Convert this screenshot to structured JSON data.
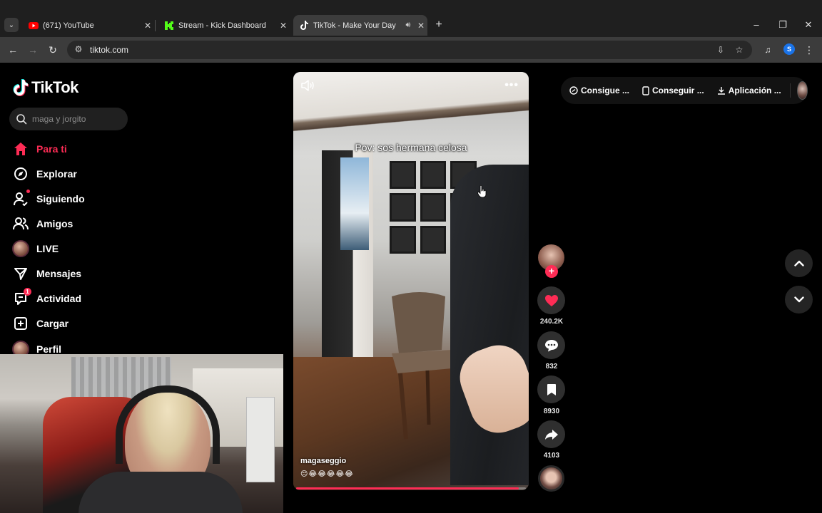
{
  "browser": {
    "tabs": [
      {
        "title": "(671) YouTube",
        "favicon": "youtube-icon"
      },
      {
        "title": "Stream - Kick Dashboard",
        "favicon": "kick-icon"
      },
      {
        "title": "TikTok - Make Your Day",
        "favicon": "tiktok-icon",
        "active": true,
        "audio": true
      }
    ],
    "url": "tiktok.com",
    "profile_initial": "S"
  },
  "sidebar": {
    "logo_text": "TikTok",
    "search_placeholder": "maga y jorgito",
    "nav": [
      {
        "label": "Para ti",
        "icon": "home-icon",
        "active": true
      },
      {
        "label": "Explorar",
        "icon": "compass-icon"
      },
      {
        "label": "Siguiendo",
        "icon": "following-icon"
      },
      {
        "label": "Amigos",
        "icon": "friends-icon"
      },
      {
        "label": "LIVE",
        "icon": "live-avatar-icon"
      },
      {
        "label": "Mensajes",
        "icon": "messages-icon"
      },
      {
        "label": "Actividad",
        "icon": "activity-icon",
        "badge": "1"
      },
      {
        "label": "Cargar",
        "icon": "upload-icon"
      },
      {
        "label": "Perfil",
        "icon": "profile-avatar-icon"
      }
    ]
  },
  "video": {
    "caption": "Pov: sos hermana celosa",
    "author": "magaseggio",
    "emojis": "😔😂😂😂😂😂",
    "progress": 0.97
  },
  "actions": {
    "likes": "240.2K",
    "comments": "832",
    "saves": "8930",
    "shares": "4103"
  },
  "top_bar": {
    "items": [
      "Consigue ...",
      "Conseguir ...",
      "Aplicación ..."
    ]
  },
  "colors": {
    "accent": "#fe2c55",
    "background": "#000000"
  }
}
